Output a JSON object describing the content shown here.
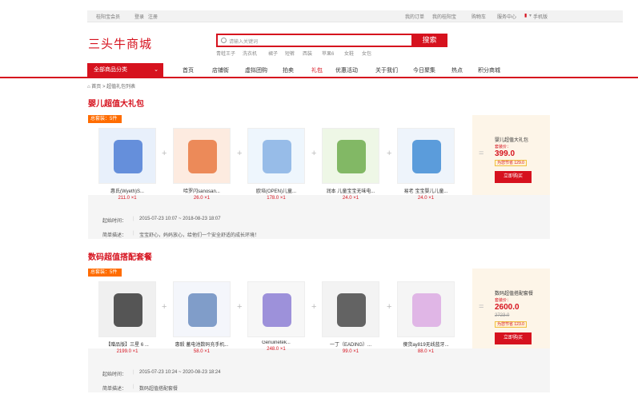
{
  "topbar": {
    "welcome": "桂阳宝会员",
    "login": "登录",
    "register": "注册",
    "my_orders": "我的订单",
    "my_shop": "我的桂阳宝",
    "cart": "购物车",
    "service": "服务中心",
    "mobile": "手机版"
  },
  "header": {
    "logo": "三头牛商城",
    "search_placeholder": "请输入关键词",
    "search_button": "搜索",
    "hot_keywords": [
      "青蛙王子",
      "洗衣机",
      "裙子",
      "短裤",
      "西装",
      "苹果6",
      "女鞋",
      "女包"
    ]
  },
  "nav": {
    "all_categories": "全部商品分类",
    "items": [
      "首页",
      "店铺街",
      "虚拟团购",
      "拍卖",
      "礼包",
      "优惠活动",
      "关于我们",
      "今日聚集",
      "热点",
      "积分商城"
    ],
    "active_index": 4
  },
  "breadcrumb": "首页 > 超值礼包列表",
  "bundles": [
    {
      "title": "婴儿超值大礼包",
      "badge": "总套装：5件",
      "products": [
        {
          "name": "惠氏(Wyeth)S...",
          "price": "211.0 ×1"
        },
        {
          "name": "哈罗闪sanosan...",
          "price": "26.0 ×1"
        },
        {
          "name": "欧培(OPEN)儿童...",
          "price": "178.0 ×1"
        },
        {
          "name": "润本 儿童宝宝无味电...",
          "price": "24.0 ×1"
        },
        {
          "name": "易老 宝宝婴儿儿童...",
          "price": "24.0 ×1"
        }
      ],
      "side": {
        "title": "婴儿超值大礼包",
        "price_label": "套装价：",
        "price": "399.0",
        "original": "",
        "saving_label": "为您节省",
        "saving": "129.0",
        "buy": "立即购买"
      },
      "start_label": "起始时间：",
      "start_value": "2015-07-23 10:07 ~ 2018-08-23 18:07",
      "desc_label": "简单描述：",
      "desc_value": "宝宝舒心，妈妈放心，给他们一个安全舒适的成长环境！"
    },
    {
      "title": "数码超值搭配套餐",
      "badge": "总套装：5件",
      "products": [
        {
          "name": "【赠品版】三星 6 ...",
          "price": "2199.0 ×1"
        },
        {
          "name": "惠毅 蓄电池数码充手机...",
          "price": "58.0 ×1"
        },
        {
          "name": "Genuinetek...",
          "price": "248.0 ×1"
        },
        {
          "name": "一丁（EADING）...",
          "price": "99.0 ×1"
        },
        {
          "name": "傻货ay819无线蓝牙...",
          "price": "88.0 ×1"
        }
      ],
      "side": {
        "title": "数码超值搭配套餐",
        "price_label": "套装价：",
        "price": "2600.0",
        "original": "2723.0",
        "saving_label": "为您节省",
        "saving": "123.0",
        "buy": "立即购买"
      },
      "start_label": "起始时间：",
      "start_value": "2015-07-23 10:24 ~ 2020-08-23 18:24",
      "desc_label": "简单描述：",
      "desc_value": "数码超值搭配套餐"
    }
  ]
}
